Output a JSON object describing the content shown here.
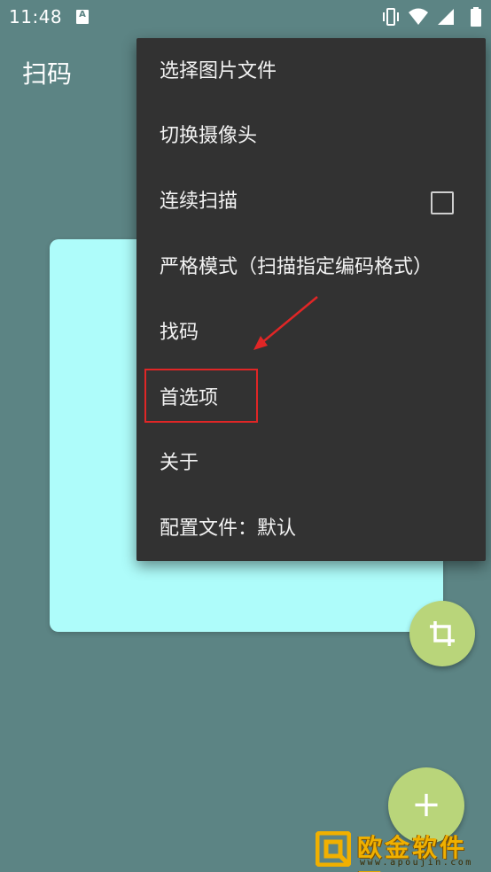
{
  "status_bar": {
    "time": "11:48",
    "notification_icon": "A",
    "icons": [
      "vibrate-icon",
      "wifi-icon",
      "signal-icon",
      "battery-icon"
    ]
  },
  "app_bar": {
    "title": "扫码"
  },
  "menu": {
    "items": [
      {
        "label": "选择图片文件"
      },
      {
        "label": "切换摄像头"
      },
      {
        "label": "连续扫描",
        "has_checkbox": true,
        "checked": false
      },
      {
        "label": "严格模式（扫描指定编码格式）"
      },
      {
        "label": "找码"
      },
      {
        "label": "首选项",
        "highlighted": true
      },
      {
        "label": "关于"
      },
      {
        "label": "配置文件：默认"
      }
    ]
  },
  "fabs": {
    "crop": "crop-icon",
    "add": "+"
  },
  "watermark": {
    "name": "欧金软件园",
    "url": "www.apoujin.com"
  },
  "colors": {
    "background": "#5c8484",
    "menu": "#323232",
    "card": "#aefcfa",
    "fab": "#b9d57a",
    "annotation": "#e02626"
  }
}
